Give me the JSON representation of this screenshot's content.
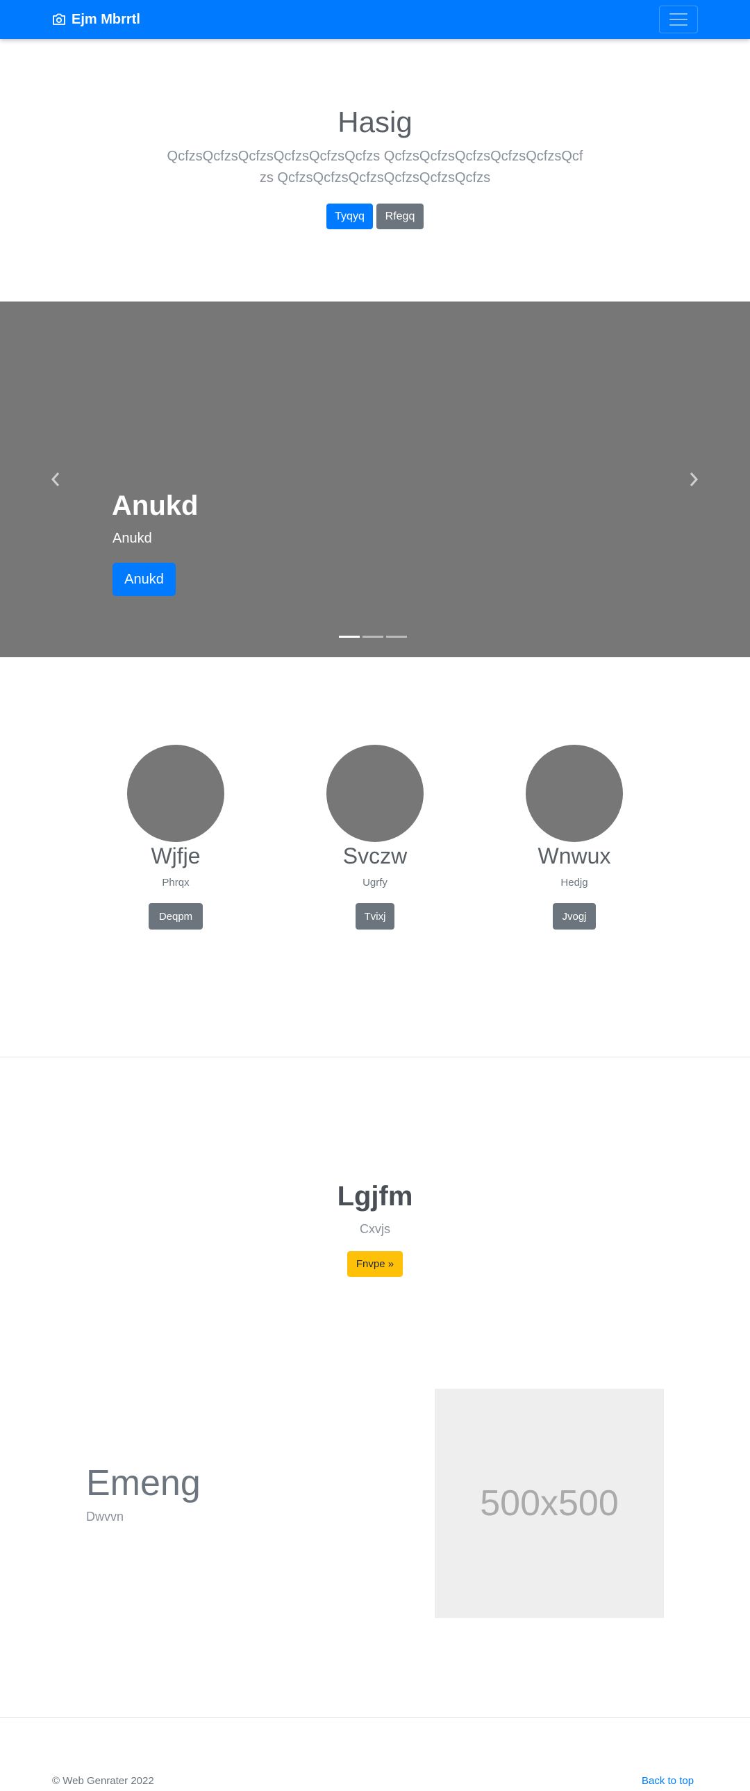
{
  "navbar": {
    "brand": "Ejm Mbrrtl",
    "brand_icon": "camera-icon",
    "toggler_icon": "hamburger-icon",
    "background": "#007bff"
  },
  "hero": {
    "title": "Hasig",
    "lead": "QcfzsQcfzsQcfzsQcfzsQcfzsQcfzs QcfzsQcfzsQcfzsQcfzsQcfzsQcfzs QcfzsQcfzsQcfzsQcfzsQcfzsQcfzs",
    "primary_button": "Tyqyq",
    "secondary_button": "Rfegq"
  },
  "carousel": {
    "title": "Anukd",
    "subtitle": "Anukd",
    "button": "Anukd",
    "prev_icon": "chevron-left-icon",
    "next_icon": "chevron-right-icon",
    "slide_count": 3,
    "active_slide": 1,
    "background": "#777777"
  },
  "features": [
    {
      "title": "Wjfje",
      "subtitle": "Phrqx",
      "button": "Deqpm"
    },
    {
      "title": "Svczw",
      "subtitle": "Ugrfy",
      "button": "Tvixj"
    },
    {
      "title": "Wnwux",
      "subtitle": "Hedjg",
      "button": "Jvogj"
    }
  ],
  "cta": {
    "title": "Lgjfm",
    "subtitle": "Cxvjs",
    "button": "Fnvpe »"
  },
  "featurette": {
    "title": "Emeng",
    "subtitle": "Dwvvn",
    "image_placeholder": "500x500"
  },
  "footer": {
    "copyright": "© Web Genrater 2022",
    "back_to_top": "Back to top"
  }
}
